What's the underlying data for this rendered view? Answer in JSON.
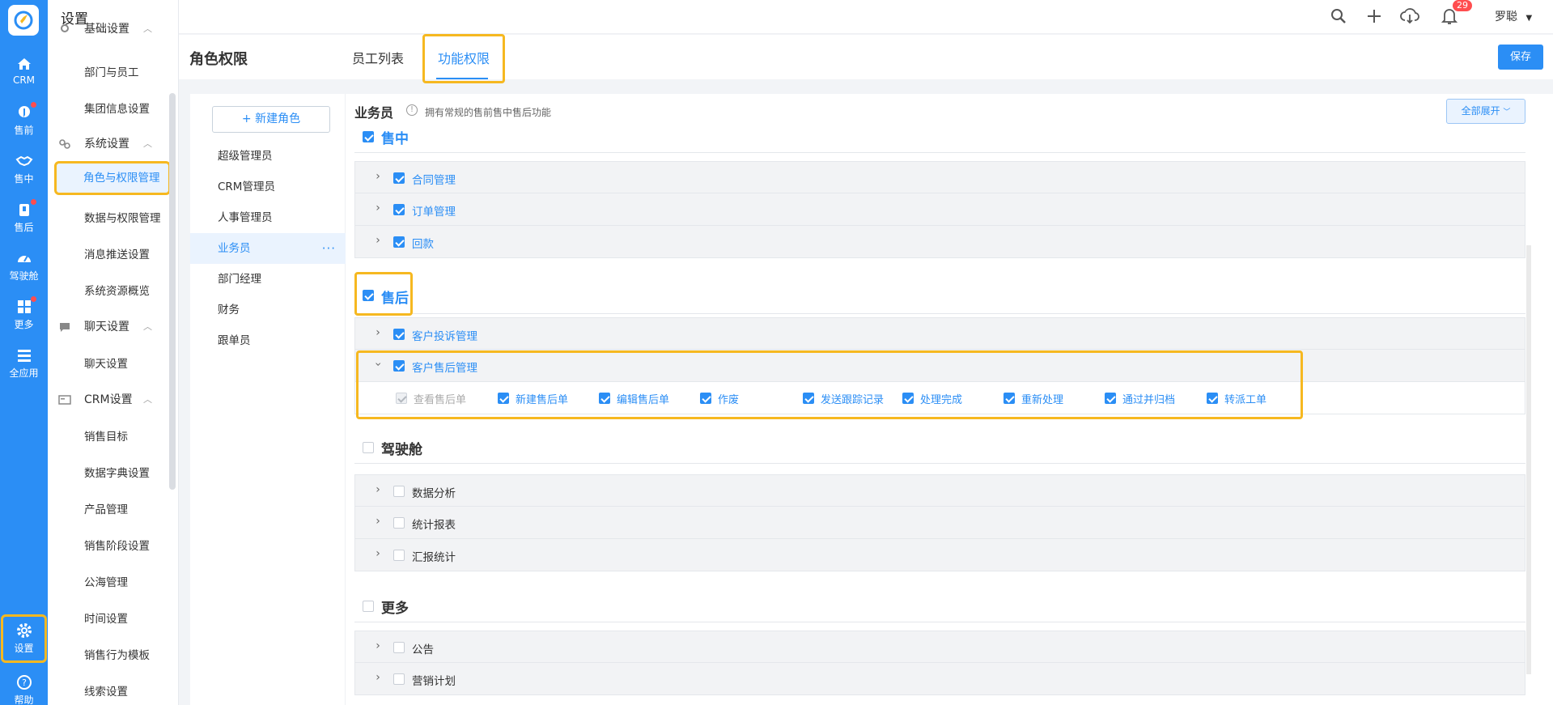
{
  "colors": {
    "accent": "#2b8ef5",
    "highlight": "#f6b820",
    "badge": "#ff4d4f"
  },
  "rail": {
    "items": [
      {
        "label": "CRM",
        "icon": "home-icon"
      },
      {
        "label": "售前",
        "icon": "pin-icon"
      },
      {
        "label": "售中",
        "icon": "handshake-icon"
      },
      {
        "label": "售后",
        "icon": "service-icon"
      },
      {
        "label": "驾驶舱",
        "icon": "dashboard-icon"
      },
      {
        "label": "更多",
        "icon": "grid-icon"
      },
      {
        "label": "全应用",
        "icon": "menu-icon"
      },
      {
        "label": "设置",
        "icon": "gear-icon"
      },
      {
        "label": "帮助",
        "icon": "help-icon"
      }
    ]
  },
  "sidebar": {
    "title": "设置",
    "items": [
      {
        "label": "基础设置"
      },
      {
        "label": "部门与员工"
      },
      {
        "label": "集团信息设置"
      },
      {
        "label": "系统设置"
      },
      {
        "label": "角色与权限管理"
      },
      {
        "label": "数据与权限管理"
      },
      {
        "label": "消息推送设置"
      },
      {
        "label": "系统资源概览"
      },
      {
        "label": "聊天设置"
      },
      {
        "label": "聊天设置"
      },
      {
        "label": "CRM设置"
      },
      {
        "label": "销售目标"
      },
      {
        "label": "数据字典设置"
      },
      {
        "label": "产品管理"
      },
      {
        "label": "销售阶段设置"
      },
      {
        "label": "公海管理"
      },
      {
        "label": "时间设置"
      },
      {
        "label": "销售行为模板"
      },
      {
        "label": "线索设置"
      }
    ]
  },
  "topbar": {
    "notification_count": "29",
    "user_name": "罗聪"
  },
  "header": {
    "title": "角色权限",
    "tabs": [
      {
        "label": "员工列表"
      },
      {
        "label": "功能权限"
      }
    ],
    "save_label": "保存"
  },
  "roles": {
    "new_label": "+ 新建角色",
    "items": [
      {
        "label": "超级管理员"
      },
      {
        "label": "CRM管理员"
      },
      {
        "label": "人事管理员"
      },
      {
        "label": "业务员"
      },
      {
        "label": "部门经理"
      },
      {
        "label": "财务"
      },
      {
        "label": "跟单员"
      }
    ],
    "more_glyph": "···"
  },
  "permissions": {
    "role_name": "业务员",
    "description": "拥有常规的售前售中售后功能",
    "expand_label": "全部展开",
    "sections": [
      {
        "label": "售中",
        "checked": true,
        "modules": [
          {
            "label": "合同管理"
          },
          {
            "label": "订单管理"
          },
          {
            "label": "回款"
          }
        ]
      },
      {
        "label": "售后",
        "checked": true,
        "modules": [
          {
            "label": "客户投诉管理"
          },
          {
            "label": "客户售后管理"
          }
        ]
      },
      {
        "label": "驾驶舱",
        "checked": false,
        "modules": [
          {
            "label": "数据分析"
          },
          {
            "label": "统计报表"
          },
          {
            "label": "汇报统计"
          }
        ]
      },
      {
        "label": "更多",
        "checked": false,
        "modules": [
          {
            "label": "公告"
          },
          {
            "label": "营销计划"
          }
        ]
      }
    ],
    "after_sales_perms": [
      {
        "label": "查看售后单"
      },
      {
        "label": "新建售后单"
      },
      {
        "label": "编辑售后单"
      },
      {
        "label": "作废"
      },
      {
        "label": "发送跟踪记录"
      },
      {
        "label": "处理完成"
      },
      {
        "label": "重新处理"
      },
      {
        "label": "通过并归档"
      },
      {
        "label": "转派工单"
      }
    ]
  }
}
